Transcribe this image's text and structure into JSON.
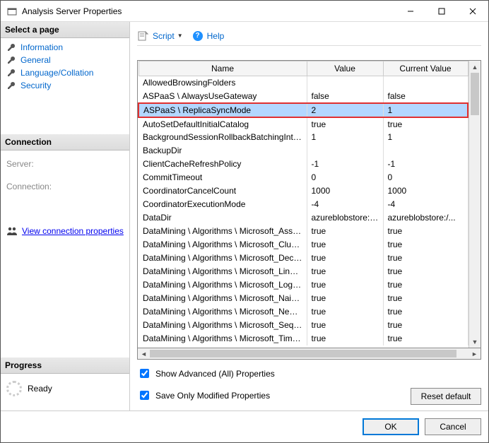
{
  "window": {
    "title": "Analysis Server Properties"
  },
  "sidebar": {
    "select_page_header": "Select a page",
    "pages": [
      {
        "label": "Information"
      },
      {
        "label": "General"
      },
      {
        "label": "Language/Collation"
      },
      {
        "label": "Security"
      }
    ],
    "connection_header": "Connection",
    "server_label": "Server:",
    "connection_label": "Connection:",
    "view_conn_props": "View connection properties",
    "progress_header": "Progress",
    "progress_status": "Ready"
  },
  "toolbar": {
    "script_label": "Script",
    "help_label": "Help"
  },
  "grid": {
    "columns": {
      "name": "Name",
      "value": "Value",
      "current": "Current Value"
    },
    "rows": [
      {
        "name": "AllowedBrowsingFolders",
        "value": "",
        "current": ""
      },
      {
        "name": "ASPaaS \\ AlwaysUseGateway",
        "value": "false",
        "current": "false"
      },
      {
        "name": "ASPaaS \\ ReplicaSyncMode",
        "value": "2",
        "current": "1",
        "selected": true
      },
      {
        "name": "AutoSetDefaultInitialCatalog",
        "value": "true",
        "current": "true"
      },
      {
        "name": "BackgroundSessionRollbackBatchingInterval",
        "value": "1",
        "current": "1"
      },
      {
        "name": "BackupDir",
        "value": "",
        "current": ""
      },
      {
        "name": "ClientCacheRefreshPolicy",
        "value": "-1",
        "current": "-1"
      },
      {
        "name": "CommitTimeout",
        "value": "0",
        "current": "0"
      },
      {
        "name": "CoordinatorCancelCount",
        "value": "1000",
        "current": "1000"
      },
      {
        "name": "CoordinatorExecutionMode",
        "value": "-4",
        "current": "-4"
      },
      {
        "name": "DataDir",
        "value": "azureblobstore:/...",
        "current": "azureblobstore:/..."
      },
      {
        "name": "DataMining \\ Algorithms \\ Microsoft_Associati...",
        "value": "true",
        "current": "true"
      },
      {
        "name": "DataMining \\ Algorithms \\ Microsoft_Clusterin...",
        "value": "true",
        "current": "true"
      },
      {
        "name": "DataMining \\ Algorithms \\ Microsoft_Decision...",
        "value": "true",
        "current": "true"
      },
      {
        "name": "DataMining \\ Algorithms \\ Microsoft_Linear_R...",
        "value": "true",
        "current": "true"
      },
      {
        "name": "DataMining \\ Algorithms \\ Microsoft_Logistic_...",
        "value": "true",
        "current": "true"
      },
      {
        "name": "DataMining \\ Algorithms \\ Microsoft_Naive_B...",
        "value": "true",
        "current": "true"
      },
      {
        "name": "DataMining \\ Algorithms \\ Microsoft_Neural_...",
        "value": "true",
        "current": "true"
      },
      {
        "name": "DataMining \\ Algorithms \\ Microsoft_Sequenc...",
        "value": "true",
        "current": "true"
      },
      {
        "name": "DataMining \\ Algorithms \\ Microsoft_Time_Se...",
        "value": "true",
        "current": "true"
      }
    ]
  },
  "options": {
    "show_advanced": "Show Advanced (All) Properties",
    "save_modified": "Save Only Modified Properties",
    "reset_default": "Reset default"
  },
  "footer": {
    "ok": "OK",
    "cancel": "Cancel"
  }
}
